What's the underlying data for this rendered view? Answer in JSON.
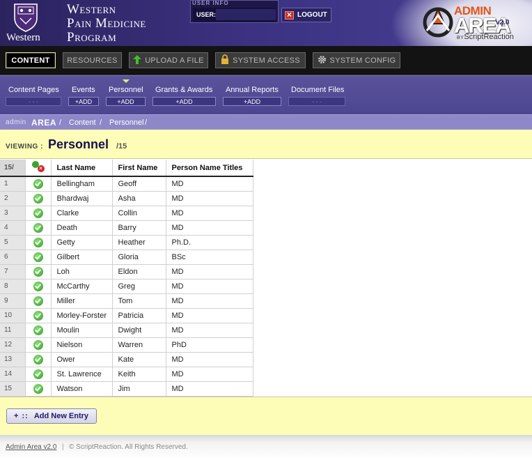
{
  "header": {
    "crest_label": "Western",
    "program_lines": [
      "Western",
      "Pain Medicine",
      "Program"
    ],
    "user_info_label": "USER INFO",
    "user_label": "USER:",
    "logout_label": "LOGOUT",
    "admin_word_top": "ADMIN",
    "admin_word_main": "AREA",
    "admin_version": "v2.0",
    "admin_by_prefix": "BY",
    "admin_by": "ScriptReaction",
    "colors": {
      "header_bg": "#3b3180",
      "accent_orange": "#e2561a"
    }
  },
  "mainnav": {
    "items": [
      {
        "label": "CONTENT",
        "icon": "",
        "active": true
      },
      {
        "label": "RESOURCES",
        "icon": ""
      },
      {
        "label": "UPLOAD A FILE",
        "icon": "upload-arrow-icon"
      },
      {
        "label": "SYSTEM ACCESS",
        "icon": "lock-icon"
      },
      {
        "label": "SYSTEM CONFIG",
        "icon": "gear-icon"
      }
    ]
  },
  "subnav": {
    "items": [
      {
        "label": "Content Pages",
        "add": "- - -"
      },
      {
        "label": "Events",
        "add": "+ADD"
      },
      {
        "label": "Personnel",
        "add": "+ADD",
        "active": true
      },
      {
        "label": "Grants & Awards",
        "add": "+ADD"
      },
      {
        "label": "Annual Reports",
        "add": "+ADD"
      },
      {
        "label": "Document Files",
        "add": "- - -"
      }
    ]
  },
  "breadcrumb": {
    "root_a": "admin",
    "root_b": "AREA",
    "sep": "/",
    "items": [
      "Content",
      "Personnel"
    ]
  },
  "viewing": {
    "label": "VIEWING :",
    "title": "Personnel",
    "count": "/15"
  },
  "table": {
    "count_header": "15/",
    "columns": [
      "Last Name",
      "First Name",
      "Person Name Titles"
    ],
    "rows": [
      {
        "n": "1",
        "last": "Bellingham",
        "first": "Geoff",
        "title": "MD"
      },
      {
        "n": "2",
        "last": "Bhardwaj",
        "first": "Asha",
        "title": "MD"
      },
      {
        "n": "3",
        "last": "Clarke",
        "first": "Collin",
        "title": "MD"
      },
      {
        "n": "4",
        "last": "Death",
        "first": "Barry",
        "title": "MD"
      },
      {
        "n": "5",
        "last": "Getty",
        "first": "Heather",
        "title": "Ph.D."
      },
      {
        "n": "6",
        "last": "Gilbert",
        "first": "Gloria",
        "title": "BSc"
      },
      {
        "n": "7",
        "last": "Loh",
        "first": "Eldon",
        "title": "MD"
      },
      {
        "n": "8",
        "last": "McCarthy",
        "first": "Greg",
        "title": "MD"
      },
      {
        "n": "9",
        "last": "Miller",
        "first": "Tom",
        "title": "MD"
      },
      {
        "n": "10",
        "last": "Morley-Forster",
        "first": "Patricia",
        "title": "MD"
      },
      {
        "n": "11",
        "last": "Moulin",
        "first": "Dwight",
        "title": "MD"
      },
      {
        "n": "12",
        "last": "Nielson",
        "first": "Warren",
        "title": "PhD"
      },
      {
        "n": "13",
        "last": "Ower",
        "first": "Kate",
        "title": "MD"
      },
      {
        "n": "14",
        "last": "St. Lawrence",
        "first": "Keith",
        "title": "MD"
      },
      {
        "n": "15",
        "last": "Watson",
        "first": "Jim",
        "title": "MD"
      }
    ]
  },
  "actions": {
    "add_prefix": "+ ::",
    "add_label": "Add New Entry"
  },
  "footer": {
    "link": "Admin Area v2.0",
    "sep": "|",
    "copyright": "© ScriptReaction. All Rights Reserved."
  }
}
